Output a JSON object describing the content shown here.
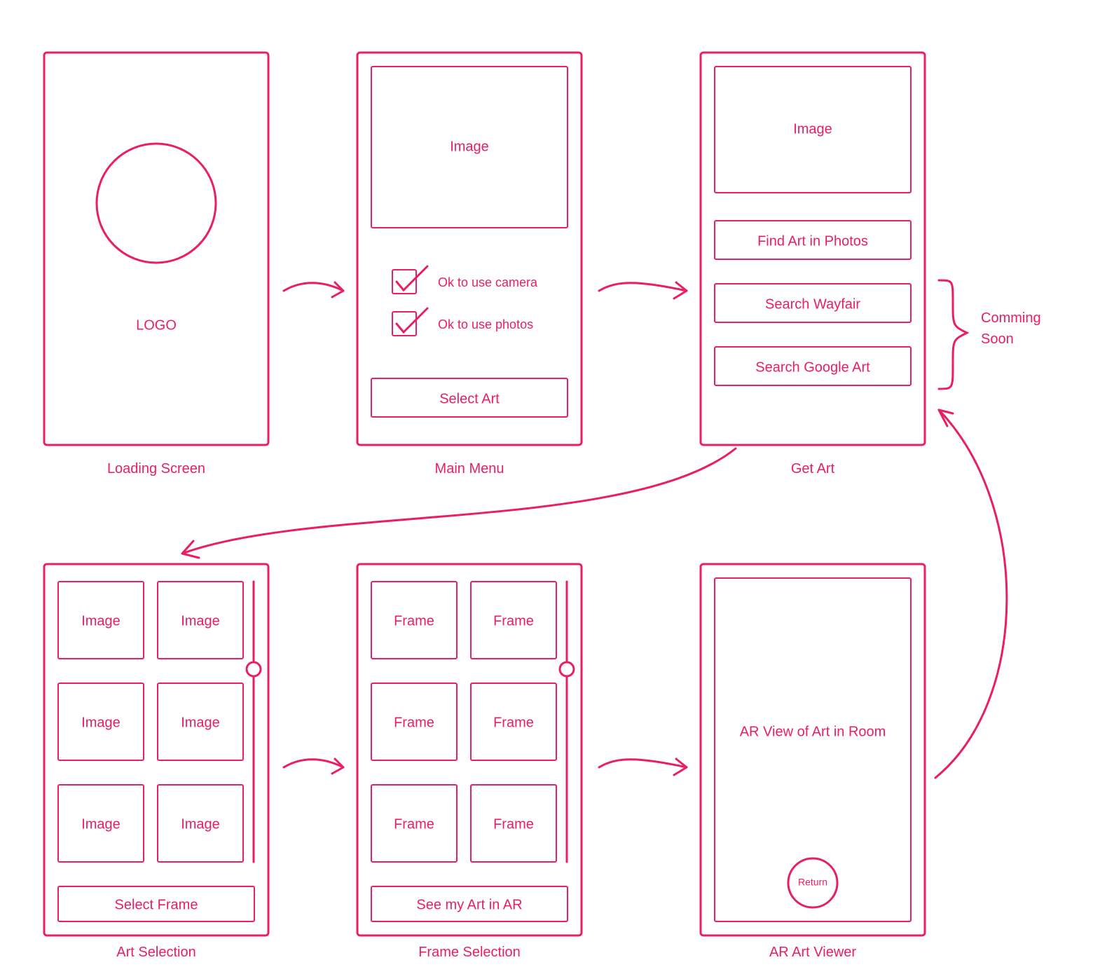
{
  "screens": {
    "loading": {
      "caption": "Loading Screen",
      "logo_text": "LOGO"
    },
    "main_menu": {
      "caption": "Main Menu",
      "image_placeholder": "Image",
      "checkbox1_label": "Ok to use camera",
      "checkbox2_label": "Ok to use photos",
      "button_label": "Select Art"
    },
    "get_art": {
      "caption": "Get Art",
      "image_placeholder": "Image",
      "button1_label": "Find Art in Photos",
      "button2_label": "Search Wayfair",
      "button3_label": "Search Google Art",
      "side_note_line1": "Comming",
      "side_note_line2": "Soon"
    },
    "art_selection": {
      "caption": "Art Selection",
      "tile_label": "Image",
      "button_label": "Select Frame"
    },
    "frame_selection": {
      "caption": "Frame Selection",
      "tile_label": "Frame",
      "button_label": "See my Art in AR"
    },
    "ar_viewer": {
      "caption": "AR Art Viewer",
      "center_text": "AR View of Art in Room",
      "return_label": "Return"
    }
  },
  "color": "#e91e63"
}
